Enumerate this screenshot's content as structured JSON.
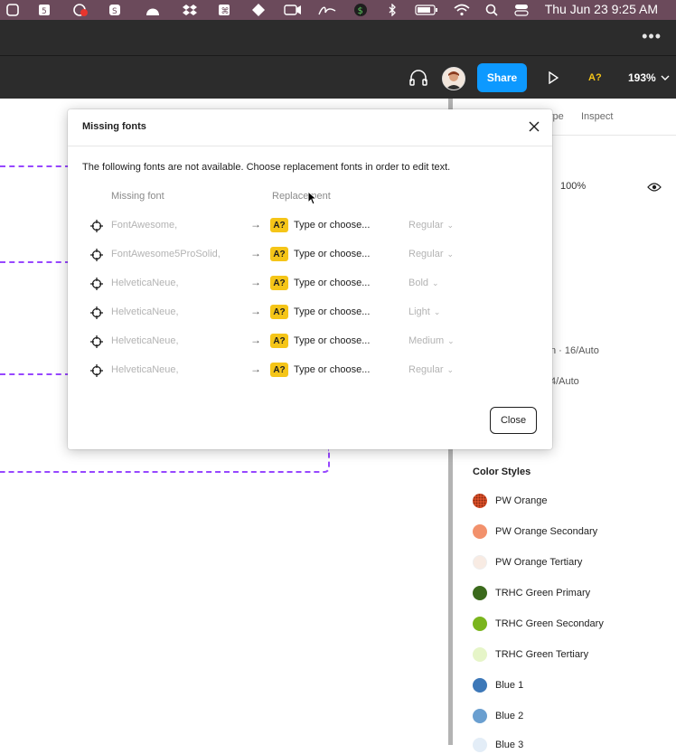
{
  "menubar": {
    "clock": "Thu Jun 23  9:25 AM"
  },
  "toolbar": {
    "share_label": "Share",
    "font_warning_label": "A?",
    "zoom_label": "193%"
  },
  "panel": {
    "tabs": [
      "ype",
      "Inspect"
    ],
    "opacity_value": "100%",
    "text_style_1": "n · 16/Auto",
    "text_style_2": "4/Auto",
    "color_styles_title": "Color Styles",
    "color_styles": [
      {
        "name": "PW Orange",
        "color": "#e8552d",
        "pattern": true
      },
      {
        "name": "PW Orange Secondary",
        "color": "#f2916c"
      },
      {
        "name": "PW Orange Tertiary",
        "color": "#f8ebe3"
      },
      {
        "name": "TRHC Green Primary",
        "color": "#3b6a1c"
      },
      {
        "name": "TRHC Green Secondary",
        "color": "#7ab51d"
      },
      {
        "name": "TRHC Green Tertiary",
        "color": "#e6f5c8"
      },
      {
        "name": "Blue 1",
        "color": "#3d78b8"
      },
      {
        "name": "Blue 2",
        "color": "#6a9fd0"
      },
      {
        "name": "Blue 3",
        "color": "#e3edf7"
      }
    ]
  },
  "modal": {
    "title": "Missing fonts",
    "description": "The following fonts are not available. Choose replacement fonts in order to edit text.",
    "col_missing": "Missing font",
    "col_replacement": "Replacement",
    "badge": "A?",
    "arrow": "→",
    "rows": [
      {
        "missing": "FontAwesome,",
        "replacement": "Type or choose...",
        "style": "Regular"
      },
      {
        "missing": "FontAwesome5ProSolid,",
        "replacement": "Type or choose...",
        "style": "Regular"
      },
      {
        "missing": "HelveticaNeue,",
        "replacement": "Type or choose...",
        "style": "Bold"
      },
      {
        "missing": "HelveticaNeue,",
        "replacement": "Type or choose...",
        "style": "Light"
      },
      {
        "missing": "HelveticaNeue,",
        "replacement": "Type or choose...",
        "style": "Medium"
      },
      {
        "missing": "HelveticaNeue,",
        "replacement": "Type or choose...",
        "style": "Regular"
      }
    ],
    "close_label": "Close"
  }
}
